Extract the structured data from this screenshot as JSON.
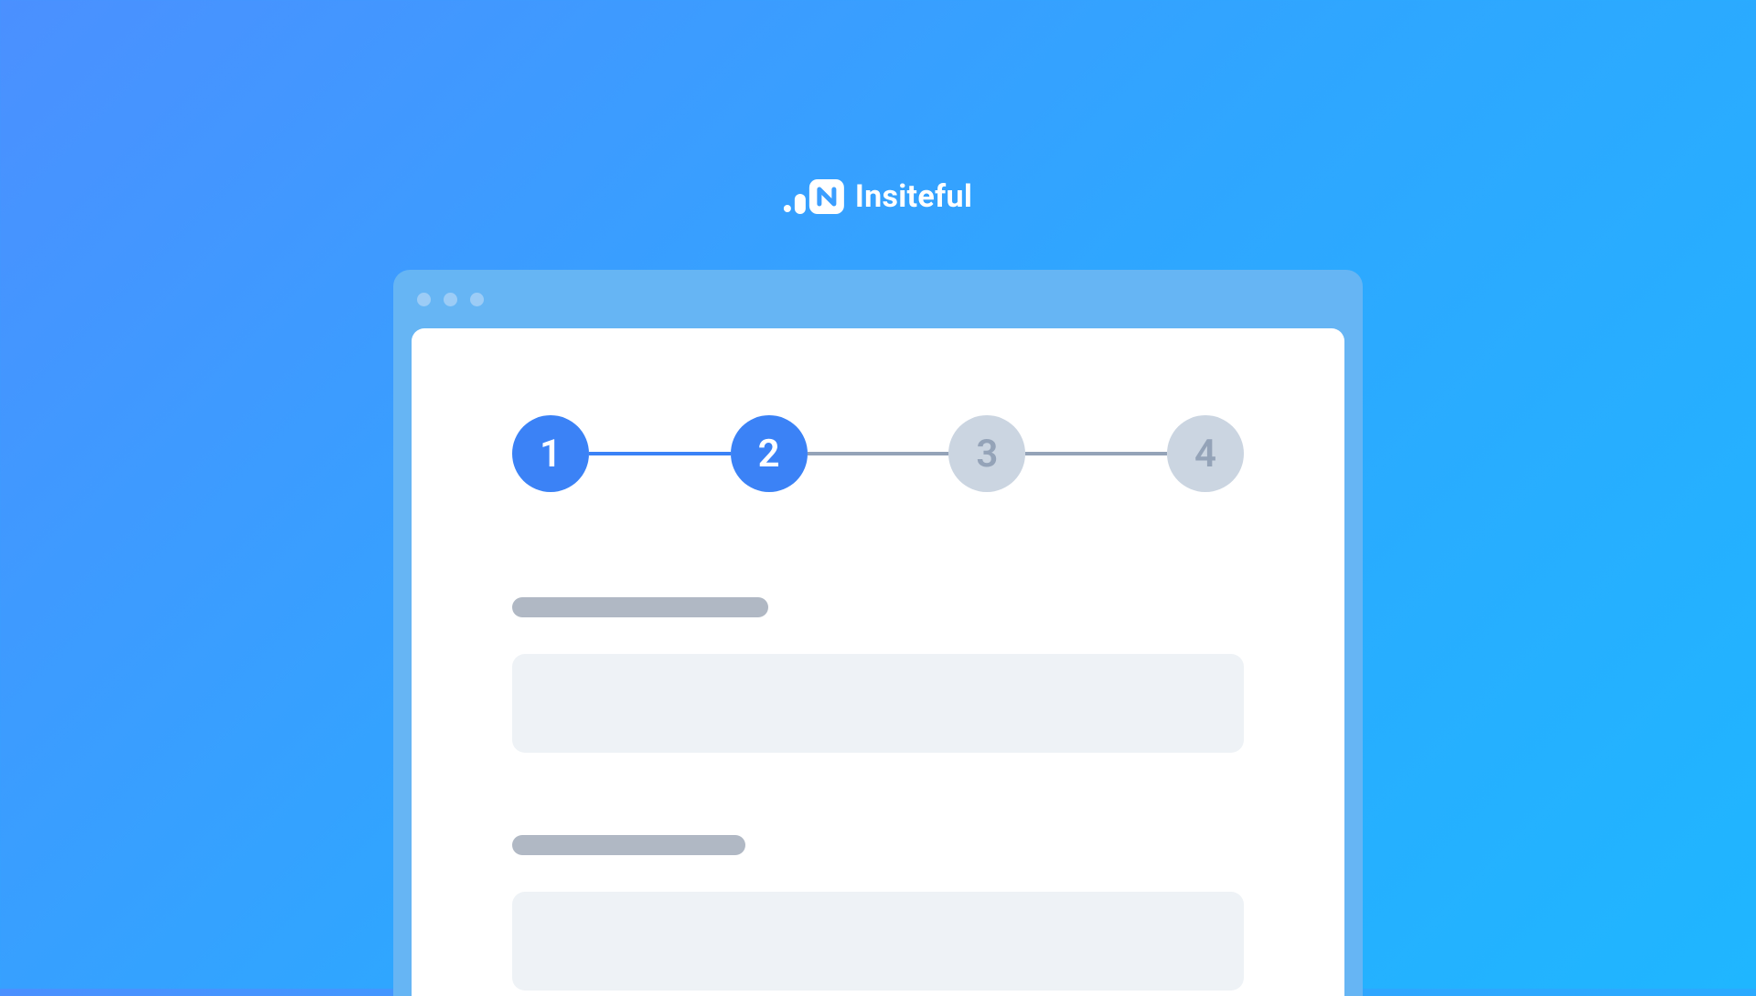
{
  "brand": {
    "name": "Insiteful"
  },
  "colors": {
    "active": "#3b82f6",
    "inactive_bg": "#cbd5e1",
    "inactive_text": "#94a3b8",
    "skeleton_label": "#b0b8c4",
    "skeleton_input": "#eef2f6"
  },
  "stepper": {
    "current_step": 2,
    "steps": [
      {
        "number": "1",
        "state": "active"
      },
      {
        "number": "2",
        "state": "active"
      },
      {
        "number": "3",
        "state": "inactive"
      },
      {
        "number": "4",
        "state": "inactive"
      }
    ],
    "connectors": [
      "active",
      "inactive",
      "inactive"
    ]
  }
}
